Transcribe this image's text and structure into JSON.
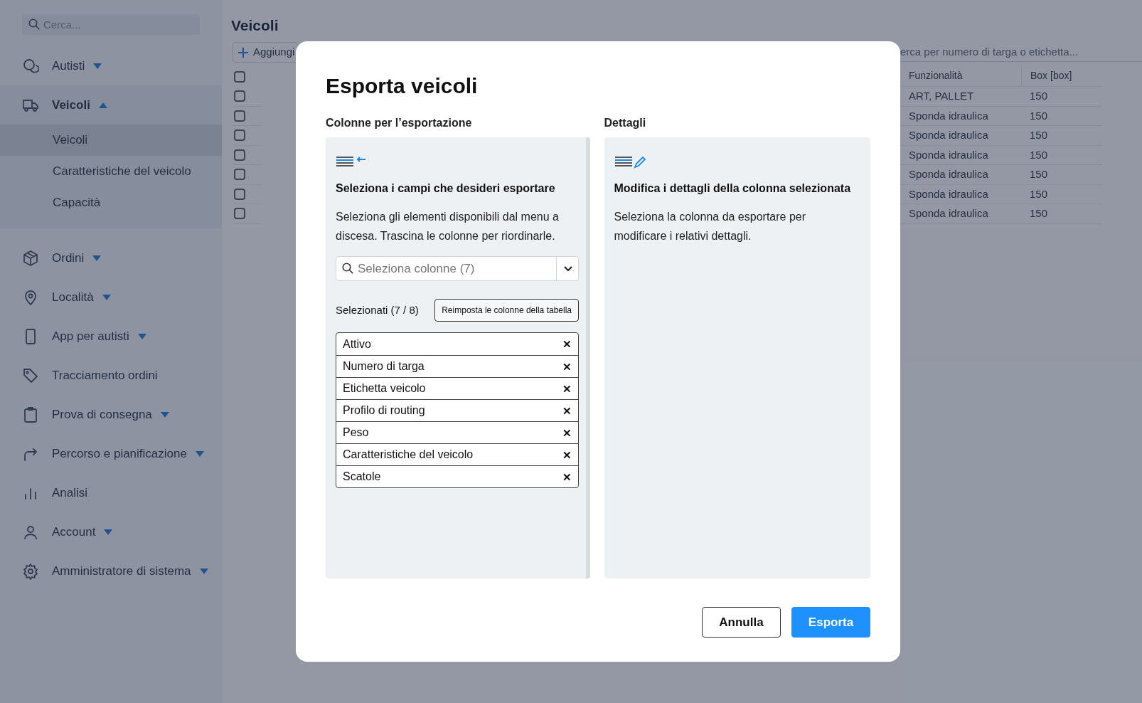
{
  "sidebar": {
    "search": {
      "placeholder": "Cerca..."
    },
    "items": [
      {
        "label": "Autisti",
        "expanded": false,
        "has_caret": true
      },
      {
        "label": "Veicoli",
        "expanded": true,
        "has_caret": true,
        "children": [
          {
            "label": "Veicoli",
            "selected": true
          },
          {
            "label": "Caratteristiche del veicolo",
            "selected": false
          },
          {
            "label": "Capacità",
            "selected": false
          }
        ]
      },
      {
        "label": "Ordini",
        "expanded": false,
        "has_caret": true
      },
      {
        "label": "Località",
        "expanded": false,
        "has_caret": true
      },
      {
        "label": "App per autisti",
        "expanded": false,
        "has_caret": true
      },
      {
        "label": "Tracciamento ordini",
        "expanded": false,
        "has_caret": false
      },
      {
        "label": "Prova di consegna",
        "expanded": false,
        "has_caret": true
      },
      {
        "label": "Percorso e pianificazione",
        "expanded": false,
        "has_caret": true
      },
      {
        "label": "Analisi",
        "expanded": false,
        "has_caret": false
      },
      {
        "label": "Account",
        "expanded": false,
        "has_caret": true
      },
      {
        "label": "Amministratore di sistema",
        "expanded": false,
        "has_caret": true
      }
    ]
  },
  "page": {
    "title": "Veicoli",
    "add_button": "Aggiungi",
    "search": {
      "placeholder": "erca per numero di targa o etichetta..."
    },
    "table": {
      "columns": [
        "Funzionalità",
        "Box [box]"
      ],
      "rows": [
        {
          "checked": false,
          "cells": [
            "ART, PALLET",
            "150"
          ]
        },
        {
          "checked": false,
          "cells": [
            "Sponda idraulica",
            "150"
          ]
        },
        {
          "checked": false,
          "cells": [
            "Sponda idraulica",
            "150"
          ]
        },
        {
          "checked": false,
          "cells": [
            "Sponda idraulica",
            "150"
          ]
        },
        {
          "checked": false,
          "cells": [
            "Sponda idraulica",
            "150"
          ]
        },
        {
          "checked": false,
          "cells": [
            "Sponda idraulica",
            "150"
          ]
        },
        {
          "checked": false,
          "cells": [
            "Sponda idraulica",
            "150"
          ]
        }
      ],
      "header_checked": false
    }
  },
  "dialog": {
    "title": "Esporta veicoli",
    "left": {
      "label": "Colonne per l’esportazione",
      "heading": "Seleziona i campi che desideri esportare",
      "text": "Seleziona gli elementi disponibili dal menu a discesa. Trascina le colonne per riordinarle.",
      "select": {
        "placeholder": "Seleziona colonne (7)"
      },
      "count": "Selezionati (7 / 8)",
      "reset_button": "Reimposta le colonne della tabella",
      "columns": [
        {
          "label": "Attivo",
          "remove": "✕"
        },
        {
          "label": "Numero di targa",
          "remove": "✕"
        },
        {
          "label": "Etichetta veicolo",
          "remove": "✕"
        },
        {
          "label": "Profilo di routing",
          "remove": "✕"
        },
        {
          "label": "Peso",
          "remove": "✕"
        },
        {
          "label": "Caratteristiche del veicolo",
          "remove": "✕"
        },
        {
          "label": "Scatole",
          "remove": "✕"
        }
      ]
    },
    "right": {
      "label": "Dettagli",
      "heading": "Modifica i dettagli della colonna selezionata",
      "text": "Seleziona la colonna da esportare per modificare i relativi dettagli."
    },
    "buttons": [
      {
        "label": "Annulla",
        "kind": "secondary"
      },
      {
        "label": "Esporta",
        "kind": "primary"
      }
    ]
  }
}
